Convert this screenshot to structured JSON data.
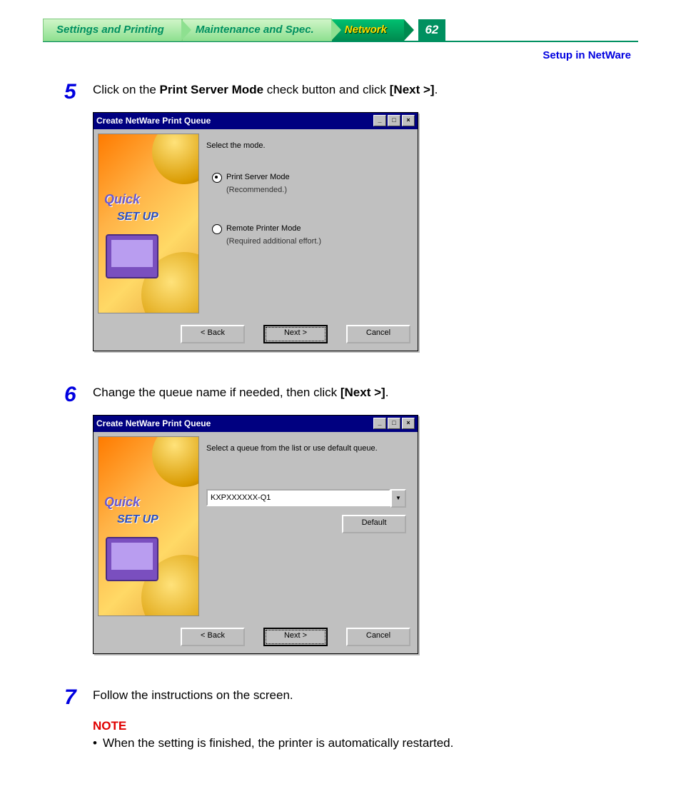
{
  "tabs": {
    "t1": "Settings and Printing",
    "t2": "Maintenance and Spec.",
    "t3": "Network",
    "page": "62"
  },
  "subhead": "Setup in NetWare",
  "step5": {
    "num": "5",
    "pre": "Click on the ",
    "bold1": "Print Server Mode",
    "mid": " check button and click ",
    "bold2": "[Next >]",
    "post": "."
  },
  "step6": {
    "num": "6",
    "pre": "Change the queue name if needed, then click ",
    "bold1": "[Next >]",
    "post": "."
  },
  "step7": {
    "num": "7",
    "text": "Follow the instructions on the screen."
  },
  "dlg": {
    "title": "Create NetWare Print Queue",
    "min": "_",
    "max": "□",
    "close": "×",
    "mode_prompt": "Select the mode.",
    "opt1": "Print Server Mode",
    "opt1_sub": "(Recommended.)",
    "opt2": "Remote Printer Mode",
    "opt2_sub": "(Required additional effort.)",
    "queue_prompt": "Select a queue from the list or use default queue.",
    "queue_value": "KXPXXXXXX-Q1",
    "default_btn": "Default",
    "back": "< Back",
    "next": "Next >",
    "cancel": "Cancel"
  },
  "sideimg": {
    "l1": "Quick",
    "l2": "SET UP"
  },
  "note": {
    "head": "NOTE",
    "bullet": "•",
    "text": "When the setting is finished, the printer is automatically restarted."
  }
}
